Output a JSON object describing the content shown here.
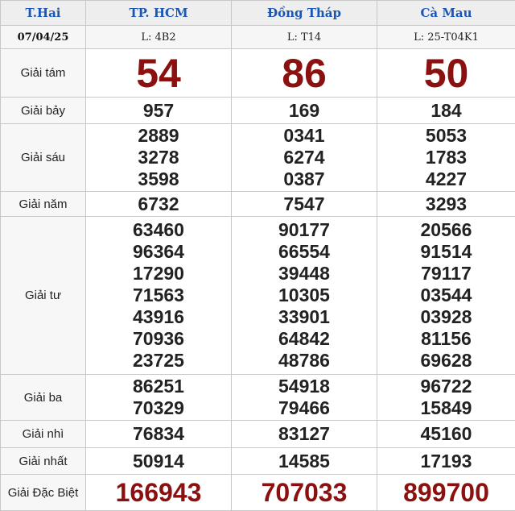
{
  "header": {
    "weekday": "T.Hai",
    "date": "07/04/25",
    "provinces": [
      {
        "name": "TP. HCM",
        "code": "L: 4B2"
      },
      {
        "name": "Đồng Tháp",
        "code": "L: T14"
      },
      {
        "name": "Cà Mau",
        "code": "L: 25-T04K1"
      }
    ]
  },
  "prizes": {
    "g8": {
      "label": "Giải tám",
      "values": [
        "54",
        "86",
        "50"
      ]
    },
    "g7": {
      "label": "Giải bảy",
      "values": [
        "957",
        "169",
        "184"
      ]
    },
    "g6": {
      "label": "Giải sáu",
      "values": [
        [
          "2889",
          "3278",
          "3598"
        ],
        [
          "0341",
          "6274",
          "0387"
        ],
        [
          "5053",
          "1783",
          "4227"
        ]
      ]
    },
    "g5": {
      "label": "Giải năm",
      "values": [
        "6732",
        "7547",
        "3293"
      ]
    },
    "g4": {
      "label": "Giải tư",
      "values": [
        [
          "63460",
          "96364",
          "17290",
          "71563",
          "43916",
          "70936",
          "23725"
        ],
        [
          "90177",
          "66554",
          "39448",
          "10305",
          "33901",
          "64842",
          "48786"
        ],
        [
          "20566",
          "91514",
          "79117",
          "03544",
          "03928",
          "81156",
          "69628"
        ]
      ]
    },
    "g3": {
      "label": "Giải ba",
      "values": [
        [
          "86251",
          "70329"
        ],
        [
          "54918",
          "79466"
        ],
        [
          "96722",
          "15849"
        ]
      ]
    },
    "g2": {
      "label": "Giải nhì",
      "values": [
        "76834",
        "83127",
        "45160"
      ]
    },
    "g1": {
      "label": "Giải nhất",
      "values": [
        "50914",
        "14585",
        "17193"
      ]
    },
    "db": {
      "label": "Giải Đặc Biệt",
      "values": [
        "166943",
        "707033",
        "899700"
      ]
    }
  },
  "colors": {
    "header_text": "#1a57b5",
    "highlight": "#8b1111",
    "border": "#c8c8c8"
  }
}
